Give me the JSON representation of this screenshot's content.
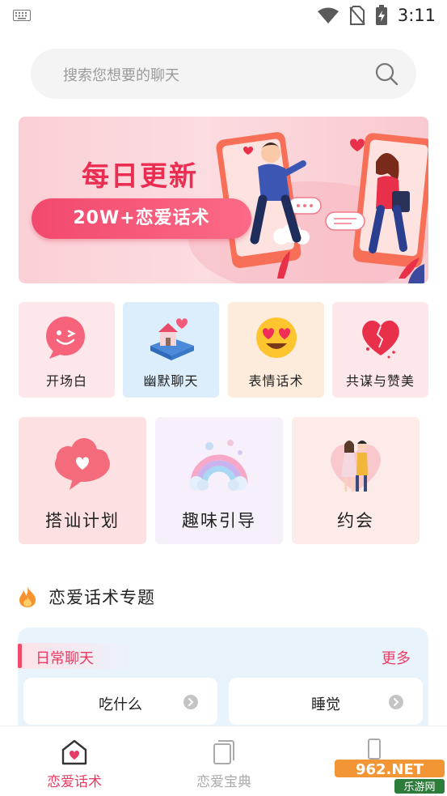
{
  "status_bar": {
    "time": "3:11",
    "icons": [
      "keyboard-icon",
      "wifi-icon",
      "no-sim-icon",
      "battery-charging-icon"
    ]
  },
  "search": {
    "placeholder": "搜索您想要的聊天",
    "icon": "search-icon"
  },
  "banner": {
    "title": "每日更新",
    "subtitle": "20W+恋爱话术"
  },
  "categories_small": [
    {
      "label": "开场白",
      "icon": "wink-face-icon",
      "bg": "#fde7ea"
    },
    {
      "label": "幽默聊天",
      "icon": "heart-house-icon",
      "bg": "#dcedfb"
    },
    {
      "label": "表情话术",
      "icon": "heart-eyes-emoji-icon",
      "bg": "#fdebdc"
    },
    {
      "label": "共谋与赞美",
      "icon": "broken-heart-icon",
      "bg": "#fde7ea"
    }
  ],
  "categories_big": [
    {
      "label": "搭讪计划",
      "icon": "heart-cloud-icon",
      "bg": "#fde1e2"
    },
    {
      "label": "趣味引导",
      "icon": "rainbow-icon",
      "bg": "#f7effa"
    },
    {
      "label": "约会",
      "icon": "couple-icon",
      "bg": "#fdebe9"
    }
  ],
  "section": {
    "title": "恋爱话术专题",
    "icon": "fire-icon"
  },
  "topic": {
    "name": "日常聊天",
    "more": "更多",
    "chips": [
      {
        "label": "吃什么"
      },
      {
        "label": "睡觉"
      }
    ]
  },
  "bottom_nav": {
    "items": [
      {
        "label": "恋爱话术",
        "icon": "heart-home-icon",
        "active": true
      },
      {
        "label": "恋爱宝典",
        "icon": "book-icon",
        "active": false
      },
      {
        "label": "",
        "icon": "phone-icon",
        "active": false
      }
    ]
  },
  "watermark": {
    "brand": "962.NET",
    "caption": "乐游网"
  },
  "colors": {
    "accent": "#ec2d52",
    "nav_active": "#e63b63",
    "nav_inactive": "#aaaaaa",
    "topic_bg": "#e9f3fc"
  }
}
